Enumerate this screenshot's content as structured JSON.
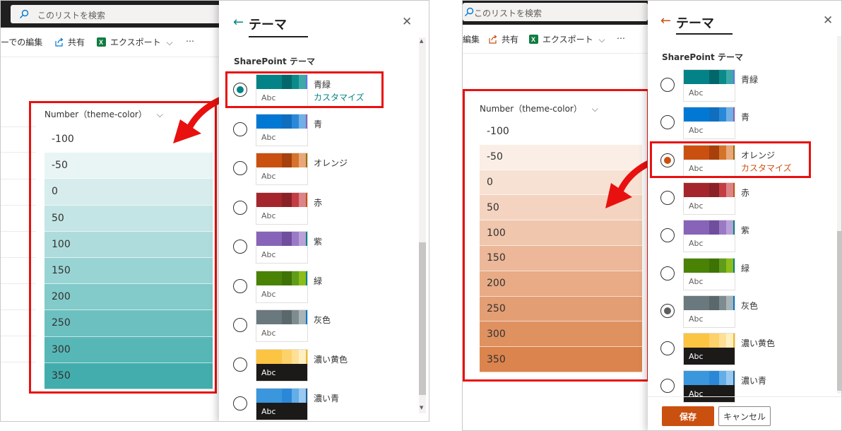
{
  "search_placeholder": "このリストを検索",
  "commands": {
    "edit_label": "ーでの編集",
    "edit_label_right": "編集",
    "share_label": "共有",
    "export_label": "エクスポート",
    "more_label": "⋯"
  },
  "column_header": {
    "left": "Number（theme-color）",
    "right": "Number（theme-color）"
  },
  "rows": [
    "-100",
    "-50",
    "0",
    "50",
    "100",
    "150",
    "200",
    "250",
    "300",
    "350"
  ],
  "pane": {
    "title": "テーマ",
    "section_title": "SharePoint テーマ",
    "customize_label": "カスタマイズ",
    "save_label": "保存",
    "cancel_label": "キャンセル"
  },
  "themes": [
    {
      "name": "青緑",
      "colors": [
        "#038387",
        "#02676b",
        "#0b8a8a",
        "#3ca8a8",
        "#5c77f0"
      ]
    },
    {
      "name": "青",
      "colors": [
        "#0078d4",
        "#106ebe",
        "#2b88d8",
        "#71afe5",
        "#8764b8"
      ]
    },
    {
      "name": "オレンジ",
      "colors": [
        "#ca5010",
        "#a7400c",
        "#d4732b",
        "#e9a77b",
        "#986f0b"
      ]
    },
    {
      "name": "赤",
      "colors": [
        "#a4262c",
        "#8a2126",
        "#c43d43",
        "#dc8488",
        "#ca5010"
      ]
    },
    {
      "name": "紫",
      "colors": [
        "#8764b8",
        "#6f4e9e",
        "#9a7ac5",
        "#b9a0d9",
        "#038387"
      ]
    },
    {
      "name": "緑",
      "colors": [
        "#498205",
        "#3f7204",
        "#5f9c1a",
        "#8cbd18",
        "#038387"
      ]
    },
    {
      "name": "灰色",
      "colors": [
        "#69797e",
        "#5a686c",
        "#7e8c90",
        "#a9b4b7",
        "#0078d4"
      ]
    },
    {
      "name": "濃い黄色",
      "colors": [
        "#fcc443",
        "#fdd26b",
        "#fde095",
        "#fff0c2",
        "#f8b81f"
      ]
    },
    {
      "name": "濃い青",
      "colors": [
        "#3a96dd",
        "#2b88d8",
        "#62aee8",
        "#99c9f0",
        "#1b5f9c"
      ]
    }
  ],
  "left_selected_theme": "青緑",
  "right_selected_theme": "オレンジ",
  "accent": {
    "teal": "#038387",
    "orange": "#ca5010",
    "annotation": "#e8110f"
  },
  "left_row_colors": [
    "#ffffff",
    "#e9f5f5",
    "#d7eded",
    "#c3e5e5",
    "#aedcdc",
    "#99d4d4",
    "#83caca",
    "#6dc0c0",
    "#57b7b7",
    "#43adad"
  ],
  "right_row_colors": [
    "#ffffff",
    "#fbeee6",
    "#f7e1d3",
    "#f4d4c1",
    "#f0c6ad",
    "#ecb899",
    "#e8ab86",
    "#e49e73",
    "#e09160",
    "#dc844d"
  ]
}
